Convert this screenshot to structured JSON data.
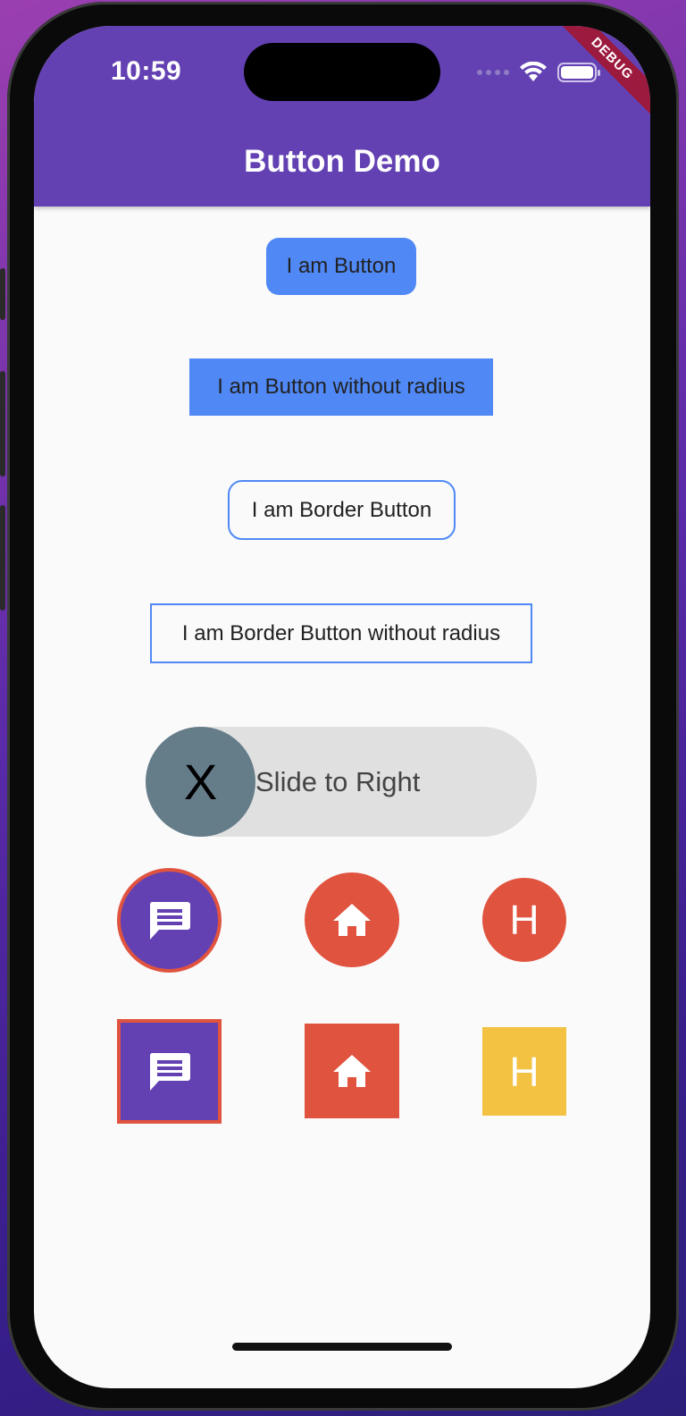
{
  "status_bar": {
    "time": "10:59",
    "debug_banner": "DEBUG"
  },
  "appbar": {
    "title": "Button Demo",
    "color": "#6341b3"
  },
  "buttons": {
    "rounded": "I am Button",
    "square": "I am Button without radius",
    "border_rounded": "I am Border Button",
    "border_square": "I am Border Button without radius"
  },
  "slider": {
    "label": "Slide to Right",
    "knob_label": "X"
  },
  "icon_buttons": {
    "circle_row": {
      "chat_icon": "chat-icon",
      "home_icon": "home-icon",
      "letter": "H"
    },
    "square_row": {
      "chat_icon": "chat-icon",
      "home_icon": "home-icon",
      "letter": "H"
    }
  },
  "colors": {
    "accent_blue": "#5089f5",
    "purple": "#6341b3",
    "red": "#e0533f",
    "yellow": "#f3c243",
    "slider_knob": "#657c89"
  }
}
